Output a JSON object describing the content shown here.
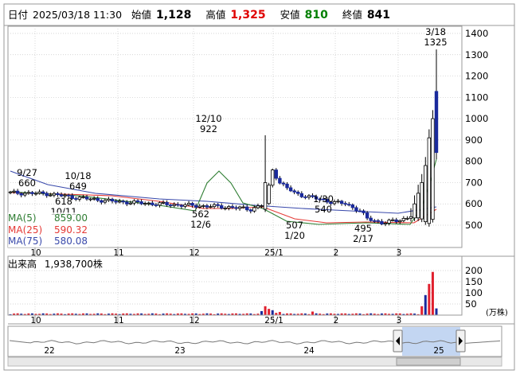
{
  "info_bar": {
    "date_label": "日付",
    "date_value": "2025/03/18 11:30",
    "open_label": "始値",
    "open_value": "1,128",
    "high_label": "高値",
    "high_value": "1,325",
    "low_label": "安値",
    "low_value": "810",
    "close_label": "終値",
    "close_value": "841"
  },
  "ma_legend": [
    {
      "label": "MA(5)",
      "value": "859.00",
      "color": "#2e7d32"
    },
    {
      "label": "MA(25)",
      "value": "590.32",
      "color": "#e53935"
    },
    {
      "label": "MA(75)",
      "value": "580.08",
      "color": "#3949ab"
    }
  ],
  "volume_panel": {
    "title": "出来高",
    "value": "1,938,700株",
    "unit": "(万株)",
    "ticks": [
      "200",
      "150",
      "100",
      "50"
    ]
  },
  "colors": {
    "up_candle": "#e0202e",
    "down_candle": "#1a2a9c",
    "grid": "#c8c8c8",
    "scroll_fill": "#b8cff0"
  },
  "chart_data": {
    "type": "candlestick",
    "y_ticks": [
      "1400",
      "1300",
      "1200",
      "1100",
      "1000",
      "900",
      "800",
      "700",
      "600",
      "500"
    ],
    "ylim": [
      450,
      1420
    ],
    "x_month_labels": [
      "10",
      "11",
      "12",
      "25/1",
      "2",
      "3"
    ],
    "volume_x_labels": [
      "10",
      "11",
      "12",
      "25/1",
      "2",
      "3"
    ],
    "overview_labels": [
      "22",
      "23",
      "24",
      "25"
    ],
    "annotations": [
      {
        "top": "9/27",
        "bottom": "660"
      },
      {
        "top": "10/18",
        "bottom": "649"
      },
      {
        "top": "618",
        "bottom": "10/11"
      },
      {
        "top": "12/10",
        "bottom": "922"
      },
      {
        "top": "562",
        "bottom": "12/6"
      },
      {
        "top": "507",
        "bottom": "1/20"
      },
      {
        "top": "1/30",
        "bottom": "540"
      },
      {
        "top": "495",
        "bottom": "2/17"
      },
      {
        "top": "3/18",
        "bottom": "1325"
      }
    ],
    "last_candles": [
      {
        "date": "3/18",
        "open": 1128,
        "high": 1325,
        "low": 810,
        "close": 841
      }
    ],
    "series": [
      {
        "name": "MA(5)",
        "last": 859.0
      },
      {
        "name": "MA(25)",
        "last": 590.32
      },
      {
        "name": "MA(75)",
        "last": 580.08
      }
    ]
  }
}
